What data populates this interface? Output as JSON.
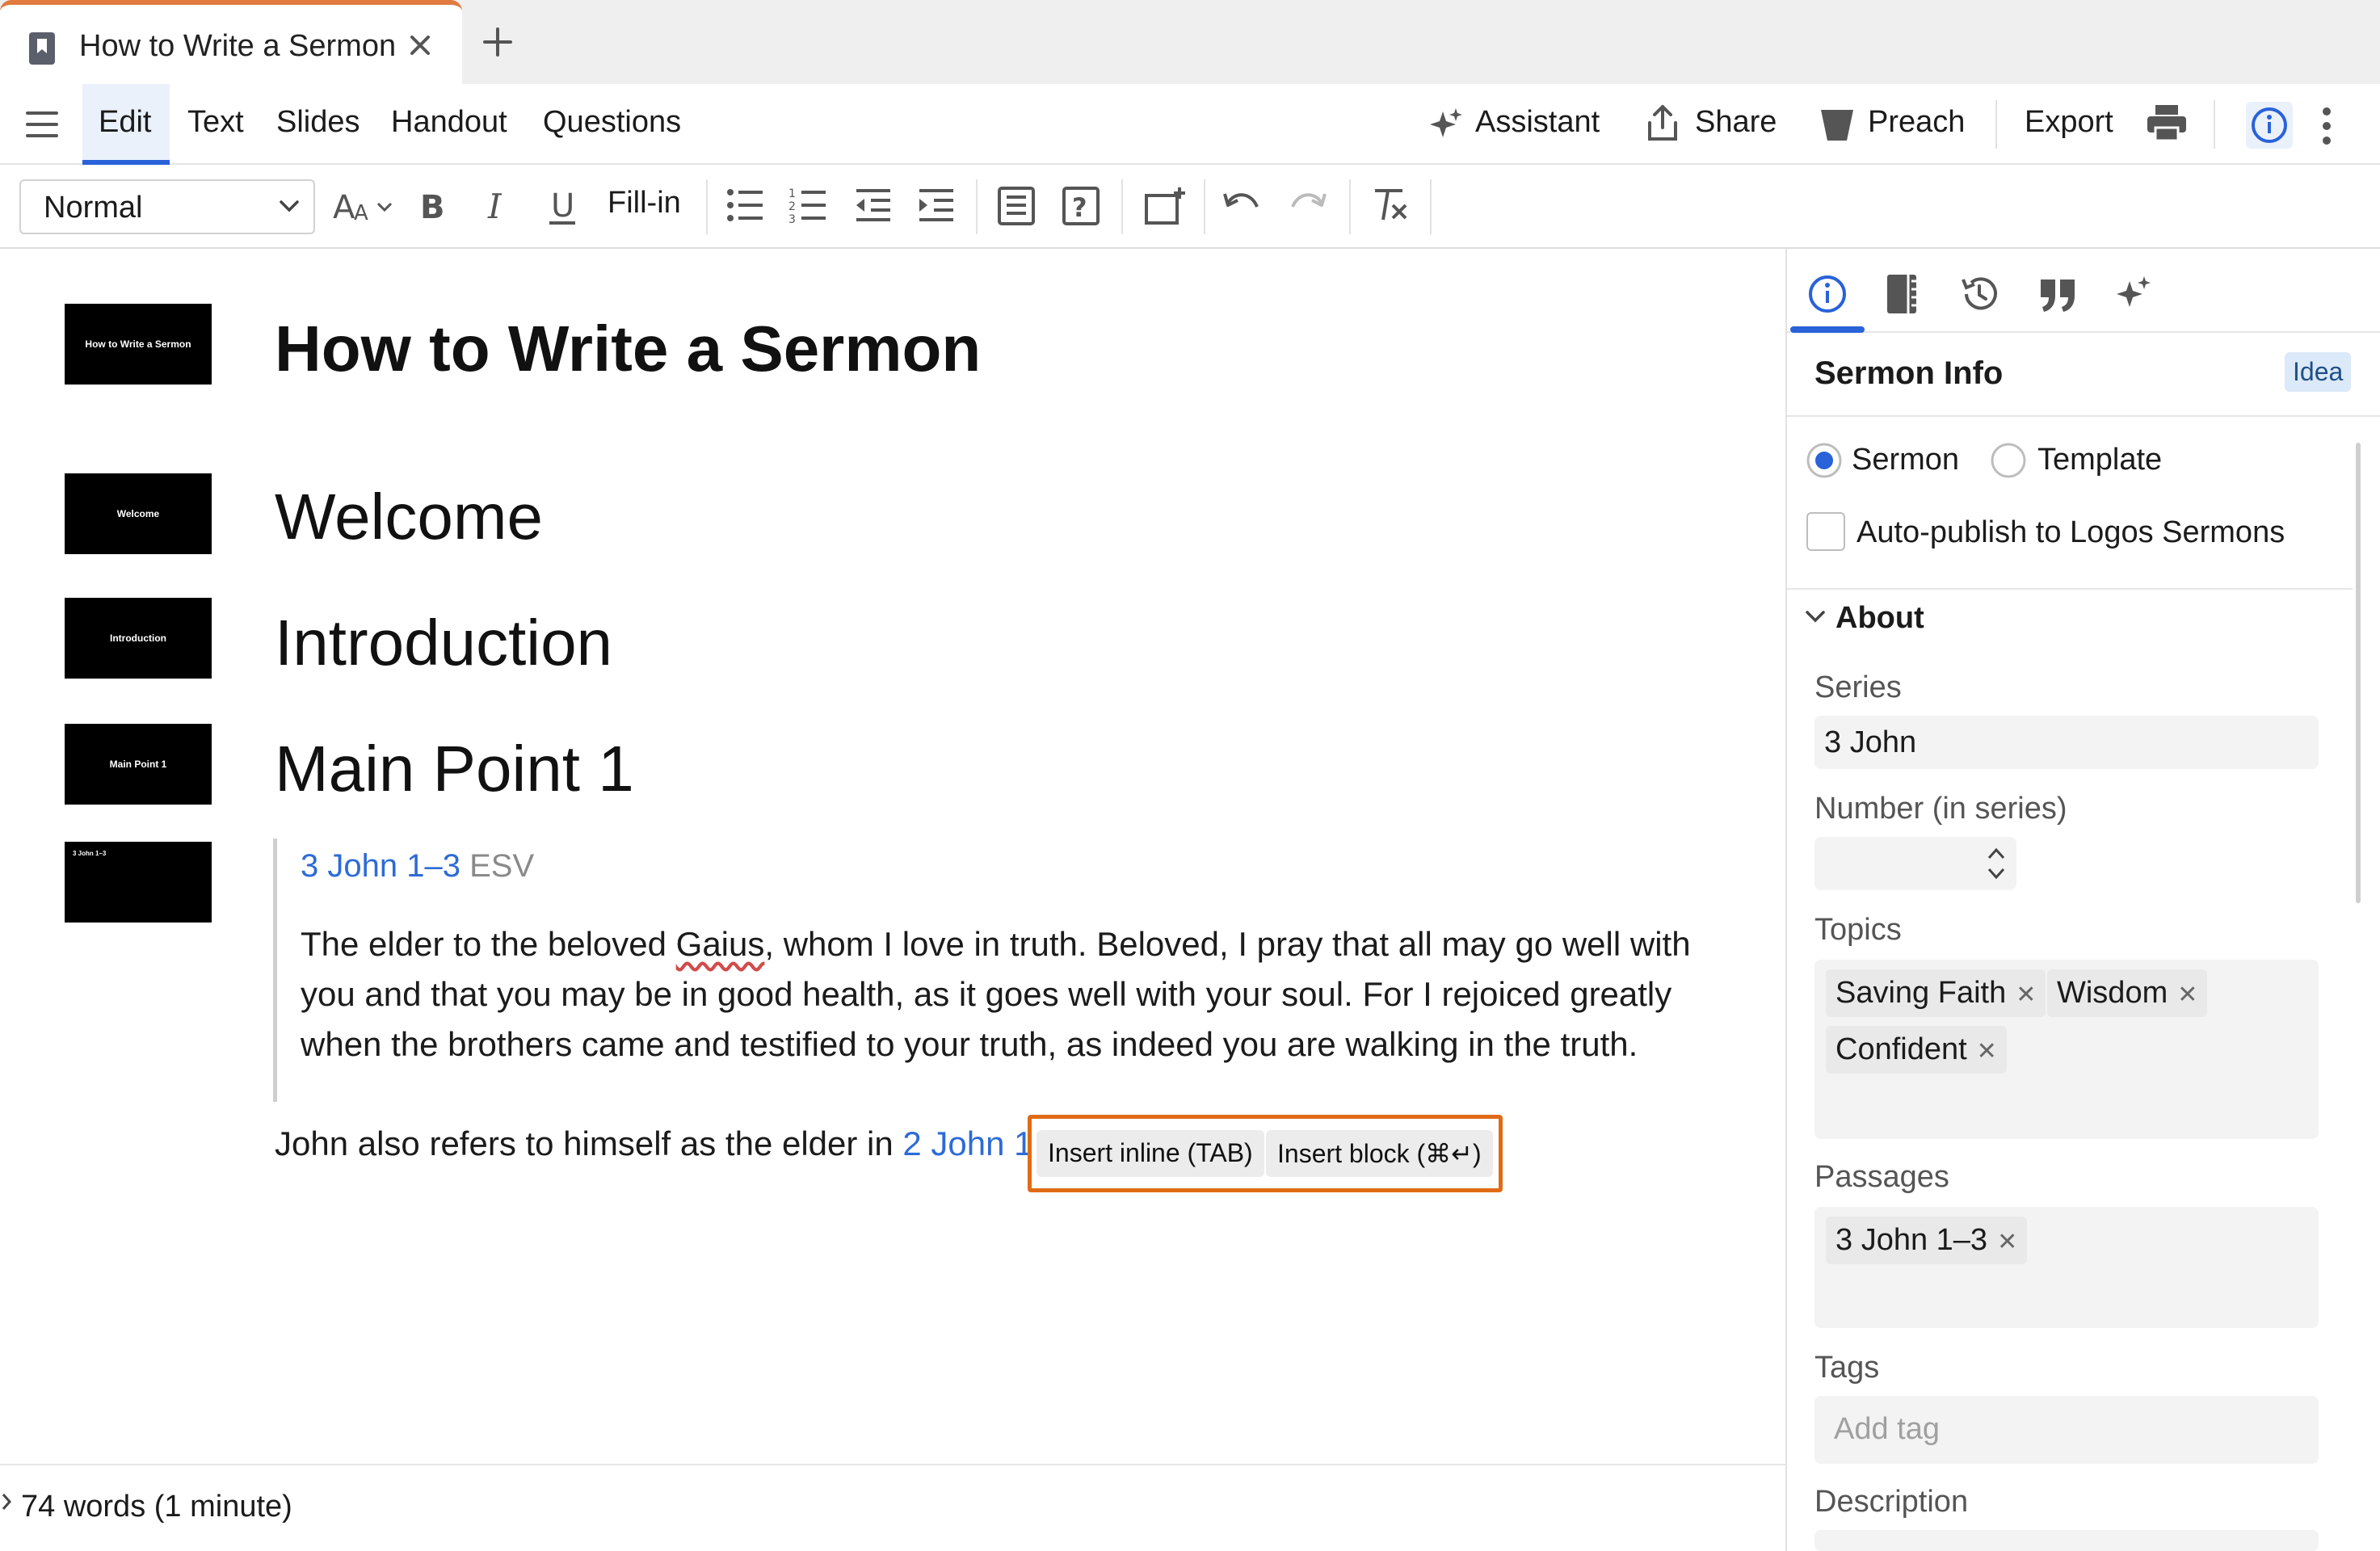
{
  "tab": {
    "title": "How to Write a Sermon"
  },
  "menu": {
    "items": [
      "Edit",
      "Text",
      "Slides",
      "Handout",
      "Questions"
    ],
    "right": {
      "assistant": "Assistant",
      "share": "Share",
      "preach": "Preach",
      "export": "Export"
    }
  },
  "toolbar": {
    "style_value": "Normal",
    "fill_in": "Fill-in"
  },
  "editor": {
    "title": "How to Write a Sermon",
    "headings": [
      "Welcome",
      "Introduction",
      "Main Point 1"
    ],
    "thumbs": [
      "How to Write a Sermon",
      "Welcome",
      "Introduction",
      "Main Point 1"
    ],
    "passage": {
      "ref": "3 John 1–3",
      "version": "ESV",
      "text_before": "The elder to the beloved ",
      "flagged_word": "Gaius",
      "text_after": ", whom I love in truth. Beloved, I pray that all may go well with you and that you may be in good health, as it goes well with your soul. For I rejoiced greatly when the brothers came and testified to your truth, as indeed you are walking in the truth."
    },
    "paragraph": {
      "text": "John also refers to himself as the elder in ",
      "link": "2 John 1"
    },
    "popup": {
      "inline": "Insert inline (TAB)",
      "block": "Insert block (⌘↵)"
    }
  },
  "status": {
    "wordcount": "74 words (1 minute)"
  },
  "panel": {
    "title": "Sermon Info",
    "badge": "Idea",
    "radio_sermon": "Sermon",
    "radio_template": "Template",
    "autopublish": "Auto-publish to Logos Sermons",
    "about": "About",
    "series_label": "Series",
    "series_value": "3 John",
    "number_label": "Number (in series)",
    "topics_label": "Topics",
    "topics": [
      "Saving Faith",
      "Wisdom",
      "Confident"
    ],
    "passages_label": "Passages",
    "passages": [
      "3 John 1–3"
    ],
    "tags_label": "Tags",
    "tags_placeholder": "Add tag",
    "description_label": "Description"
  },
  "colors": {
    "accent": "#2962d9",
    "link": "#2d6bd6",
    "highlight": "#e06b16",
    "tab_accent": "#e07a3f"
  }
}
